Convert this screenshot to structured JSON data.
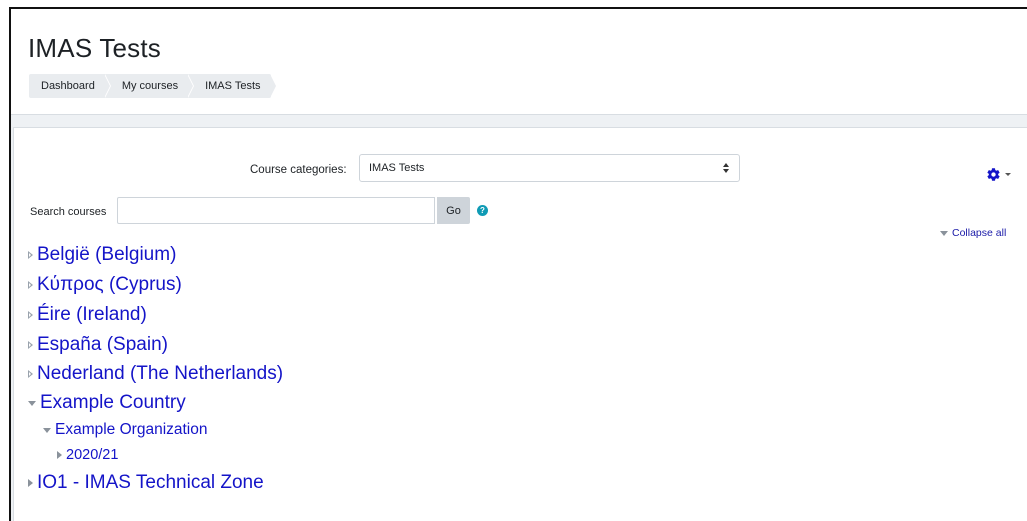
{
  "header": {
    "title": "IMAS Tests",
    "breadcrumb": [
      "Dashboard",
      "My courses",
      "IMAS Tests"
    ]
  },
  "controls": {
    "category_label": "Course categories:",
    "category_selected": "IMAS Tests",
    "search_label": "Search courses",
    "search_value": "",
    "go_label": "Go",
    "help_glyph": "?",
    "collapse_all_label": "Collapse all"
  },
  "tree": [
    {
      "label": "België (Belgium)",
      "level": 0,
      "state": "collapsed-empty"
    },
    {
      "label": "Κύπρος (Cyprus)",
      "level": 0,
      "state": "collapsed-empty"
    },
    {
      "label": "Éire (Ireland)",
      "level": 0,
      "state": "collapsed-empty"
    },
    {
      "label": "España (Spain)",
      "level": 0,
      "state": "collapsed-empty"
    },
    {
      "label": "Nederland (The Netherlands)",
      "level": 0,
      "state": "collapsed-empty"
    },
    {
      "label": "Example Country",
      "level": 0,
      "state": "expanded"
    },
    {
      "label": "Example Organization",
      "level": 1,
      "state": "expanded"
    },
    {
      "label": "2020/21",
      "level": 2,
      "state": "collapsed"
    },
    {
      "label": "IO1 - IMAS Technical Zone",
      "level": 0,
      "state": "collapsed"
    }
  ],
  "icons": {
    "settings": "gear-icon",
    "help": "help-icon",
    "expander_collapsed": "triangle-right-icon",
    "expander_expanded": "triangle-down-icon"
  },
  "colors": {
    "link": "#1414c8",
    "help": "#0f9bb5",
    "gear": "#1414c8",
    "breadcrumb_bg": "#e9ecef"
  }
}
